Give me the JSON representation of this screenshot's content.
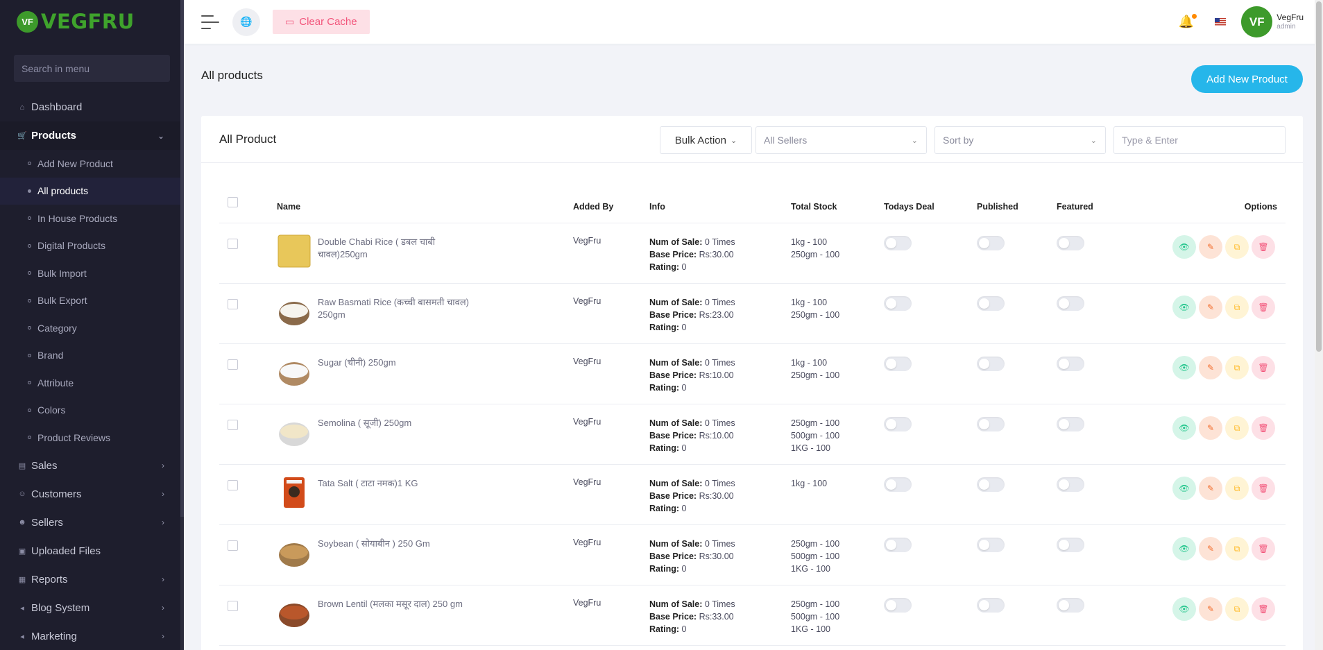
{
  "brand": {
    "logo_mark": "VF",
    "name": "VEGFRU",
    "color": "#3fa32c"
  },
  "sidebar": {
    "search_placeholder": "Search in menu",
    "items": [
      {
        "label": "Dashboard",
        "icon": "home-icon",
        "glyph": "⌂",
        "has_children": false
      },
      {
        "label": "Products",
        "icon": "cart-icon",
        "glyph": "🛒",
        "expanded": true,
        "active": true
      },
      {
        "label": "Sales",
        "icon": "money-icon",
        "glyph": "▤",
        "has_children": true
      },
      {
        "label": "Customers",
        "icon": "users-icon",
        "glyph": "☺",
        "has_children": true
      },
      {
        "label": "Sellers",
        "icon": "user-icon",
        "glyph": "☻",
        "has_children": true
      },
      {
        "label": "Uploaded Files",
        "icon": "folder-icon",
        "glyph": "▣",
        "has_children": false
      },
      {
        "label": "Reports",
        "icon": "file-icon",
        "glyph": "▦",
        "has_children": true
      },
      {
        "label": "Blog System",
        "icon": "megaphone-icon",
        "glyph": "◂",
        "has_children": true
      },
      {
        "label": "Marketing",
        "icon": "bullhorn-icon",
        "glyph": "◂",
        "has_children": true
      }
    ],
    "product_subitems": [
      "Add New Product",
      "All products",
      "In House Products",
      "Digital Products",
      "Bulk Import",
      "Bulk Export",
      "Category",
      "Brand",
      "Attribute",
      "Colors",
      "Product Reviews"
    ],
    "active_subitem": "All products"
  },
  "topbar": {
    "clear_cache": "Clear Cache",
    "user": {
      "avatar": "VF",
      "name": "VegFru",
      "role": "admin"
    }
  },
  "page": {
    "title": "All products",
    "add_button": "Add New Product"
  },
  "card": {
    "title": "All Product",
    "bulk_action": "Bulk Action",
    "sellers_select": "All Sellers",
    "sort_select": "Sort by",
    "search_placeholder": "Type & Enter"
  },
  "table": {
    "headers": {
      "name": "Name",
      "added_by": "Added By",
      "info": "Info",
      "stock": "Total Stock",
      "todays_deal": "Todays Deal",
      "published": "Published",
      "featured": "Featured",
      "options": "Options"
    },
    "info_labels": {
      "sales": "Num of Sale:",
      "price": "Base Price:",
      "rating": "Rating:"
    },
    "rows": [
      {
        "name": "Double Chabi Rice ( डबल चाबी चावल)250gm",
        "added_by": "VegFru",
        "sales": "0 Times",
        "price": "Rs:30.00",
        "rating": "0",
        "stock": [
          "1kg - 100",
          "250gm - 100"
        ],
        "img": "rice-yellow",
        "todays_deal": false,
        "published": false,
        "featured": false
      },
      {
        "name": "Raw Basmati Rice (कच्ची बासमती चावल) 250gm",
        "added_by": "VegFru",
        "sales": "0 Times",
        "price": "Rs:23.00",
        "rating": "0",
        "stock": [
          "1kg - 100",
          "250gm - 100"
        ],
        "img": "rice-bowl",
        "todays_deal": false,
        "published": false,
        "featured": false
      },
      {
        "name": "Sugar (चीनी) 250gm",
        "added_by": "VegFru",
        "sales": "0 Times",
        "price": "Rs:10.00",
        "rating": "0",
        "stock": [
          "1kg - 100",
          "250gm - 100"
        ],
        "img": "sugar-bowl",
        "todays_deal": false,
        "published": false,
        "featured": false
      },
      {
        "name": "Semolina ( सूजी) 250gm",
        "added_by": "VegFru",
        "sales": "0 Times",
        "price": "Rs:10.00",
        "rating": "0",
        "stock": [
          "250gm - 100",
          "500gm - 100",
          "1KG - 100"
        ],
        "img": "semolina-bowl",
        "todays_deal": false,
        "published": false,
        "featured": false
      },
      {
        "name": "Tata Salt ( टाटा नमक)1 KG",
        "added_by": "VegFru",
        "sales": "0 Times",
        "price": "Rs:30.00",
        "rating": "0",
        "stock": [
          "1kg - 100"
        ],
        "img": "salt-pack",
        "todays_deal": false,
        "published": false,
        "featured": false
      },
      {
        "name": "Soybean ( सोयाबीन ) 250 Gm",
        "added_by": "VegFru",
        "sales": "0 Times",
        "price": "Rs:30.00",
        "rating": "0",
        "stock": [
          "250gm - 100",
          "500gm - 100",
          "1KG - 100"
        ],
        "img": "soybean-bowl",
        "todays_deal": false,
        "published": false,
        "featured": false
      },
      {
        "name": "Brown Lentil (मलका मसूर दाल) 250 gm",
        "added_by": "VegFru",
        "sales": "0 Times",
        "price": "Rs:33.00",
        "rating": "0",
        "stock": [
          "250gm - 100",
          "500gm - 100",
          "1KG - 100"
        ],
        "img": "lentil-bowl",
        "todays_deal": false,
        "published": false,
        "featured": false
      }
    ]
  },
  "colors": {
    "sidebar_bg": "#1e1e2d",
    "accent": "#26b6ea",
    "danger_soft": "#fde0e6"
  }
}
